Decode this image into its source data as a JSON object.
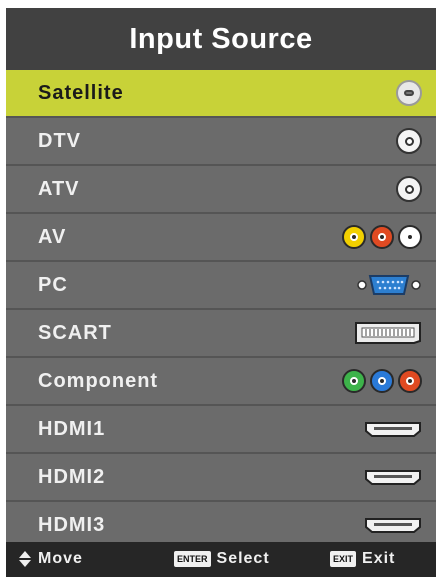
{
  "title": "Input Source",
  "sources": [
    {
      "label": "Satellite",
      "icon": "antenna-connector-icon",
      "selected": true
    },
    {
      "label": "DTV",
      "icon": "antenna-connector-icon",
      "selected": false
    },
    {
      "label": "ATV",
      "icon": "antenna-connector-icon",
      "selected": false
    },
    {
      "label": "AV",
      "icon": "rca-composite-connector-icon",
      "selected": false
    },
    {
      "label": "PC",
      "icon": "vga-connector-icon",
      "selected": false
    },
    {
      "label": "SCART",
      "icon": "scart-connector-icon",
      "selected": false
    },
    {
      "label": "Component",
      "icon": "rca-component-connector-icon",
      "selected": false
    },
    {
      "label": "HDMI1",
      "icon": "hdmi-connector-icon",
      "selected": false
    },
    {
      "label": "HDMI2",
      "icon": "hdmi-connector-icon",
      "selected": false
    },
    {
      "label": "HDMI3",
      "icon": "hdmi-connector-icon",
      "selected": false
    }
  ],
  "footer": {
    "move_label": "Move",
    "enter_key": "ENTER",
    "select_label": "Select",
    "exit_key": "EXIT",
    "exit_label": "Exit"
  },
  "colors": {
    "selected_row": "#c8d238",
    "row": "#6b6b6b",
    "title_bar": "#414141",
    "footer_bar": "#262626"
  }
}
